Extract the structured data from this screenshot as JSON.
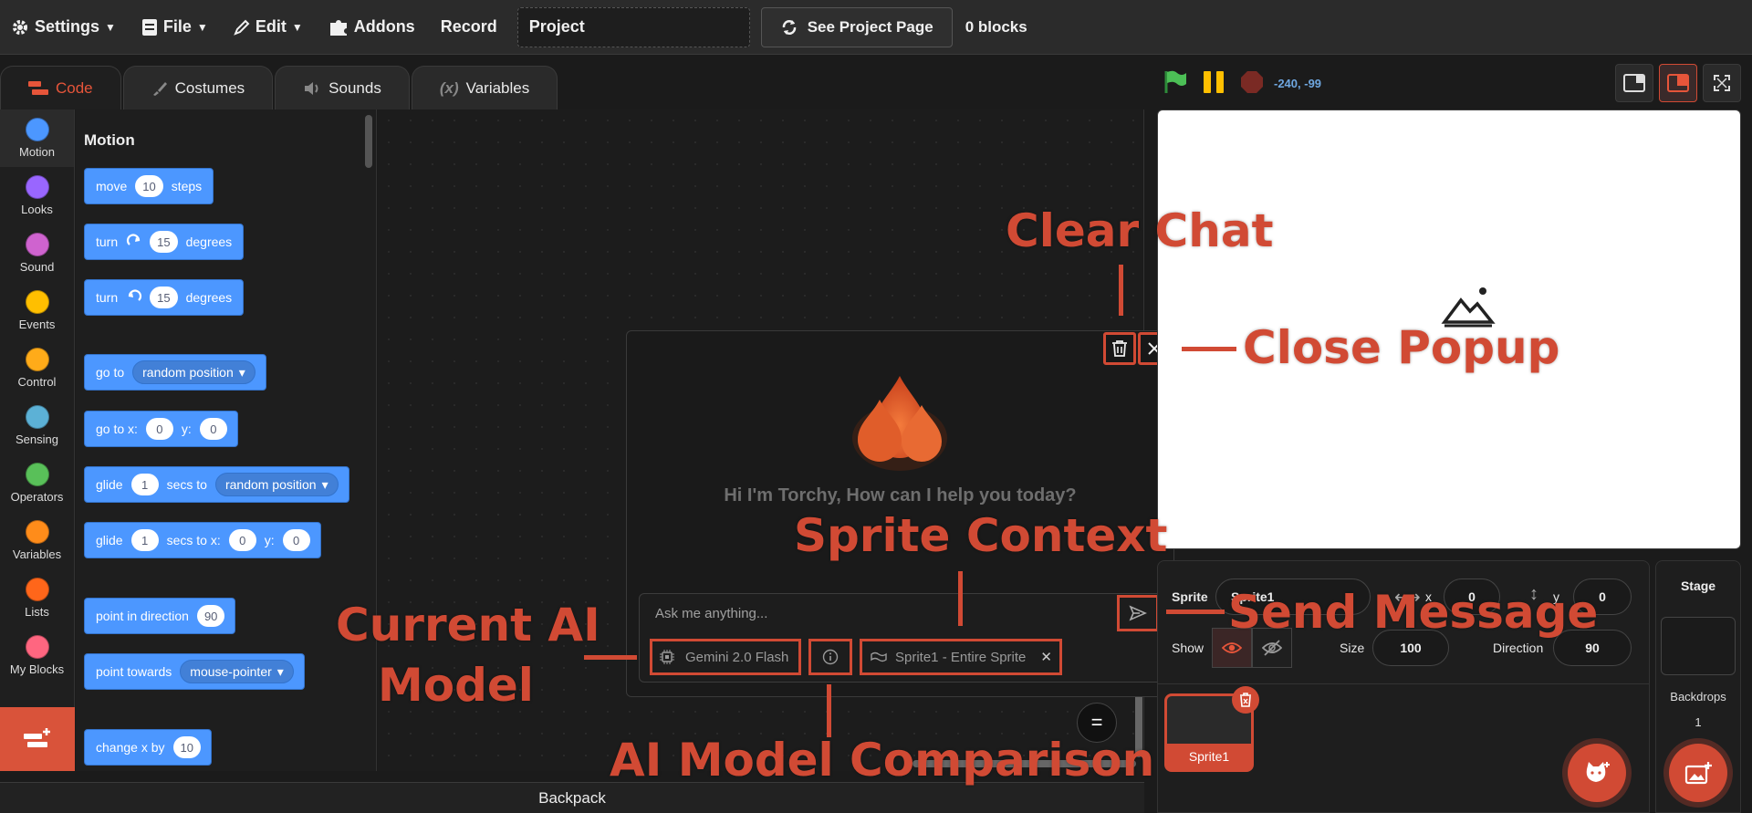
{
  "menubar": {
    "settings_label": "Settings",
    "file_label": "File",
    "edit_label": "Edit",
    "addons_label": "Addons",
    "record_label": "Record",
    "project_title_value": "Project",
    "see_project_label": "See Project Page",
    "blocks_count": "0 blocks"
  },
  "tabs": {
    "code": "Code",
    "costumes": "Costumes",
    "sounds": "Sounds",
    "variables": "Variables"
  },
  "categories": [
    {
      "label": "Motion",
      "color": "#4c97ff"
    },
    {
      "label": "Looks",
      "color": "#9966ff"
    },
    {
      "label": "Sound",
      "color": "#cf63cf"
    },
    {
      "label": "Events",
      "color": "#ffbf00"
    },
    {
      "label": "Control",
      "color": "#ffab19"
    },
    {
      "label": "Sensing",
      "color": "#5cb1d6"
    },
    {
      "label": "Operators",
      "color": "#59c059"
    },
    {
      "label": "Variables",
      "color": "#ff8c1a"
    },
    {
      "label": "Lists",
      "color": "#ff661a"
    },
    {
      "label": "My Blocks",
      "color": "#ff6680"
    }
  ],
  "palette": {
    "section_title": "Motion",
    "move": {
      "w1": "move",
      "v1": "10",
      "w2": "steps"
    },
    "turn_right": {
      "w1": "turn",
      "v1": "15",
      "w2": "degrees"
    },
    "turn_left": {
      "w1": "turn",
      "v1": "15",
      "w2": "degrees"
    },
    "goto": {
      "w1": "go to",
      "d1": "random position"
    },
    "gotoxy": {
      "w1": "go to x:",
      "v1": "0",
      "w2": "y:",
      "v2": "0"
    },
    "glide_to": {
      "w1": "glide",
      "v1": "1",
      "w2": "secs to",
      "d1": "random position"
    },
    "glide_xy": {
      "w1": "glide",
      "v1": "1",
      "w2": "secs to x:",
      "v2": "0",
      "w3": "y:",
      "v3": "0"
    },
    "point_dir": {
      "w1": "point in direction",
      "v1": "90"
    },
    "point_towards": {
      "w1": "point towards",
      "d1": "mouse-pointer"
    },
    "change_x": {
      "w1": "change x by",
      "v1": "10"
    }
  },
  "workspace": {
    "backpack_label": "Backpack"
  },
  "chat": {
    "greeting": "Hi I'm Torchy, How can I help you today?",
    "input_placeholder": "Ask me anything...",
    "model_label": "Gemini 2.0 Flash",
    "context_label": "Sprite1 - Entire Sprite"
  },
  "stage_controls": {
    "mouse_coords": "-240, -99"
  },
  "sprite_info": {
    "sprite_label": "Sprite",
    "sprite_name": "Sprite1",
    "x_label": "x",
    "x_value": "0",
    "y_label": "y",
    "y_value": "0",
    "show_label": "Show",
    "size_label": "Size",
    "size_value": "100",
    "direction_label": "Direction",
    "direction_value": "90",
    "thumb_name": "Sprite1"
  },
  "stage_pane": {
    "title": "Stage",
    "backdrops_label": "Backdrops",
    "backdrops_count": "1"
  },
  "annotations": {
    "clear_chat": "Clear Chat",
    "close_popup": "Close Popup",
    "sprite_context": "Sprite Context",
    "send_message": "Send Message",
    "current_model_line1": "Current AI",
    "current_model_line2": "Model",
    "model_comparison": "AI Model Comparison"
  },
  "colors": {
    "accent": "#d14a34",
    "motion_blue": "#4c97ff"
  }
}
